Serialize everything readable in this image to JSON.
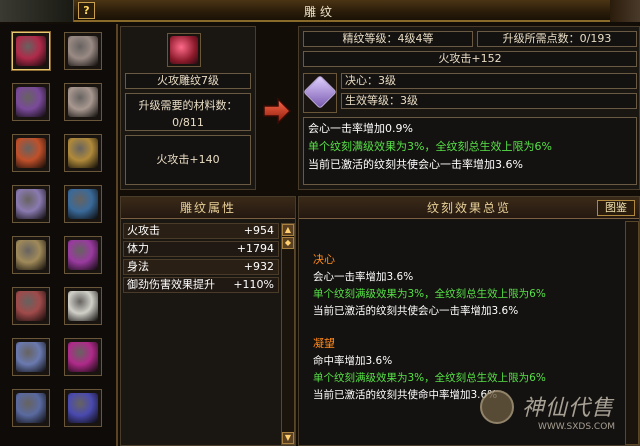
{
  "window": {
    "title": "雕纹",
    "help_label": "?"
  },
  "inventory": {
    "slots": [
      {
        "icon": "red-weapon-icon",
        "color": "#b02a4a"
      },
      {
        "icon": "ring-icon",
        "color": "#9a8a84"
      },
      {
        "icon": "armor-icon",
        "color": "#7a4a9a"
      },
      {
        "icon": "ring-icon",
        "color": "#a89890"
      },
      {
        "icon": "scroll-icon",
        "color": "#c0502a"
      },
      {
        "icon": "bracer-icon",
        "color": "#b08a3a"
      },
      {
        "icon": "amulet-icon",
        "color": "#8a7ab0"
      },
      {
        "icon": "needle-icon",
        "color": "#3a6a9a"
      },
      {
        "icon": "belt-icon",
        "color": "#a08a5a"
      },
      {
        "icon": "blade-icon",
        "color": "#9a3aa0"
      },
      {
        "icon": "tassel-icon",
        "color": "#a04a4a"
      },
      {
        "icon": "jade-icon",
        "color": "#d0d0c8"
      },
      {
        "icon": "glove-icon",
        "color": "#6a7ab0"
      },
      {
        "icon": "pendant-icon",
        "color": "#b02a8a"
      },
      {
        "icon": "boots-icon",
        "color": "#5a6aa0"
      },
      {
        "icon": "hairpin-icon",
        "color": "#4a4ab0"
      }
    ]
  },
  "current": {
    "item_name": "火攻雕纹7级",
    "materials_label": "升级需要的材料数：",
    "materials_value": "0/811",
    "effect": "火攻击+140"
  },
  "upgrade": {
    "level_label": "精纹等级：4级4等",
    "points_label": "升级所需点数：0/193",
    "effect": "火攻击+152",
    "gem_name": "决心：3级",
    "gem_level": "生效等级：3级",
    "desc": [
      {
        "text": "会心一击率增加0.9%",
        "color": "white"
      },
      {
        "text": "单个纹刻满级效果为3%，全纹刻总生效上限为6%",
        "color": "green"
      },
      {
        "text": "当前已激活的纹刻共使会心一击率增加3.6%",
        "color": "white"
      }
    ]
  },
  "attributes": {
    "title": "雕纹属性",
    "rows": [
      {
        "name": "火攻击",
        "value": "+954"
      },
      {
        "name": "体力",
        "value": "+1794"
      },
      {
        "name": "身法",
        "value": "+932"
      },
      {
        "name": "御劲伤害效果提升",
        "value": "+110%"
      }
    ]
  },
  "effects": {
    "title": "纹刻效果总览",
    "button": "图鉴",
    "groups": [
      {
        "name": "决心",
        "lines": [
          {
            "text": "会心一击率增加3.6%",
            "color": "white"
          },
          {
            "text": "单个纹刻满级效果为3%，全纹刻总生效上限为6%",
            "color": "green"
          },
          {
            "text": "当前已激活的纹刻共使会心一击率增加3.6%",
            "color": "white"
          }
        ]
      },
      {
        "name": "凝望",
        "lines": [
          {
            "text": "命中率增加3.6%",
            "color": "white"
          },
          {
            "text": "单个纹刻满级效果为3%，全纹刻总生效上限为6%",
            "color": "green"
          },
          {
            "text": "当前已激活的纹刻共使命中率增加3.6%",
            "color": "white"
          }
        ]
      }
    ]
  },
  "watermark": {
    "text": "神仙代售",
    "url": "WWW.SXDS.COM"
  },
  "colors": {
    "accent": "#c8a050",
    "green": "#56e046",
    "orange": "#ff8a1e"
  }
}
